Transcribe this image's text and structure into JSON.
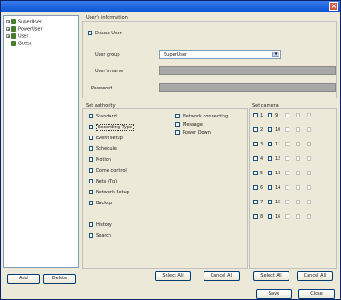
{
  "window": {
    "close_glyph": "×"
  },
  "tree": [
    {
      "label": "SuperUser",
      "expander": "+"
    },
    {
      "label": "PowerUser",
      "expander": "+"
    },
    {
      "label": "User",
      "expander": "+"
    },
    {
      "label": "Guest",
      "expander": ""
    }
  ],
  "left_buttons": {
    "add": "Add",
    "delete": "Delete"
  },
  "user_info": {
    "group_title": "User's information",
    "disuse_label": "Disuse User",
    "user_group_label": "User group",
    "user_group_value": "SuperUser",
    "user_name_label": "User's name",
    "user_name_value": "",
    "password_label": "Password",
    "password_value": ""
  },
  "authority": {
    "title": "Set authority",
    "col1": [
      "Standard",
      "Recording Type",
      "Event setup",
      "Schedule",
      "Motion",
      "Dome control",
      "Nets (Tg)",
      "Network Setup",
      "Backup",
      "History",
      "Search"
    ],
    "col2": [
      "Network connecting",
      "Message",
      "Power Down"
    ],
    "select_all": "Select All",
    "cancel_all": "Cancel All"
  },
  "cameras": {
    "title": "Set camera",
    "rows": [
      [
        "1",
        "9"
      ],
      [
        "2",
        "10"
      ],
      [
        "3",
        "11"
      ],
      [
        "4",
        "12"
      ],
      [
        "5",
        "13"
      ],
      [
        "6",
        "14"
      ],
      [
        "7",
        "15"
      ],
      [
        "8",
        "16"
      ]
    ],
    "select_all": "Select All",
    "cancel_all": "Cancel All"
  },
  "footer": {
    "save": "Save",
    "close": "Close"
  }
}
